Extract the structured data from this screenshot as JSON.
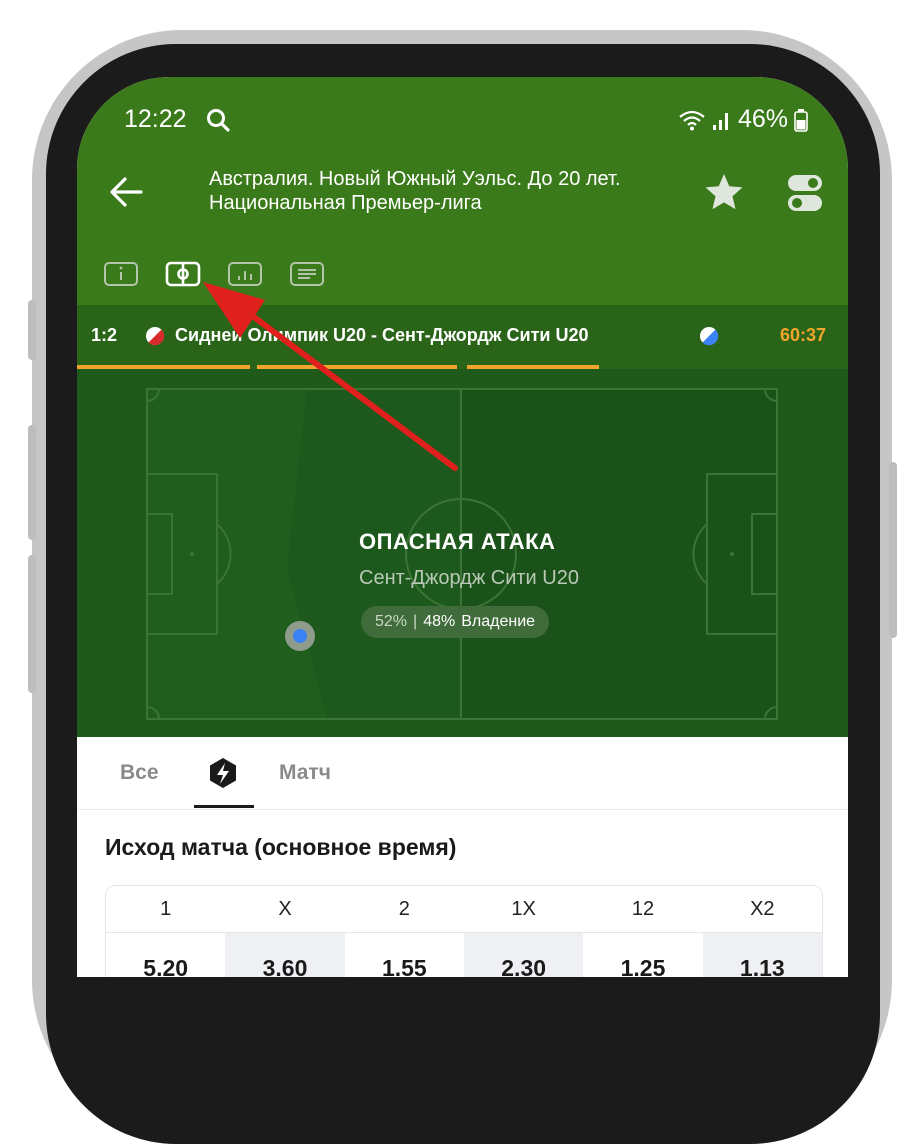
{
  "status_bar": {
    "time": "12:22",
    "battery": "46%",
    "icons": [
      "search-icon",
      "wifi-icon",
      "signal-icon",
      "battery-icon"
    ]
  },
  "header": {
    "league_title": "Австралия. Новый Южный Уэльс. До 20 лет. Национальная Премьер-лига",
    "icons": [
      "back-arrow-icon",
      "star-icon",
      "toggle-icon"
    ]
  },
  "view_tabs": [
    "info-tab-icon",
    "field-tab-icon",
    "stats-tab-icon",
    "list-tab-icon"
  ],
  "scorebar": {
    "score": "1:2",
    "teams": "Сидней Олимпик U20 - Сент-Джордж Сити U20",
    "time": "60:37",
    "progress_segments_fraction": [
      0.22,
      0.27,
      0.17
    ],
    "colors": {
      "accent": "#f1a52a",
      "home": "#d92b2b",
      "away": "#3b82f6"
    }
  },
  "event": {
    "title": "ОПАСНАЯ АТАКА",
    "team": "Сент-Джордж Сити U20",
    "possession_home": "52%",
    "possession_away": "48%",
    "possession_label": "Владение"
  },
  "market_tabs": {
    "all": "Все",
    "live_icon": "lightning-icon",
    "match": "Матч"
  },
  "market": {
    "title": "Исход матча (основное время)",
    "headers": [
      "1",
      "X",
      "2",
      "1X",
      "12",
      "X2"
    ],
    "odds": [
      "5.20",
      "3.60",
      "1.55",
      "2.30",
      "1.25",
      "1.13"
    ]
  },
  "colors": {
    "header_green": "#3a7a1a",
    "pitch_green": "#1f5a1b",
    "annotation_red": "#e0201d"
  }
}
